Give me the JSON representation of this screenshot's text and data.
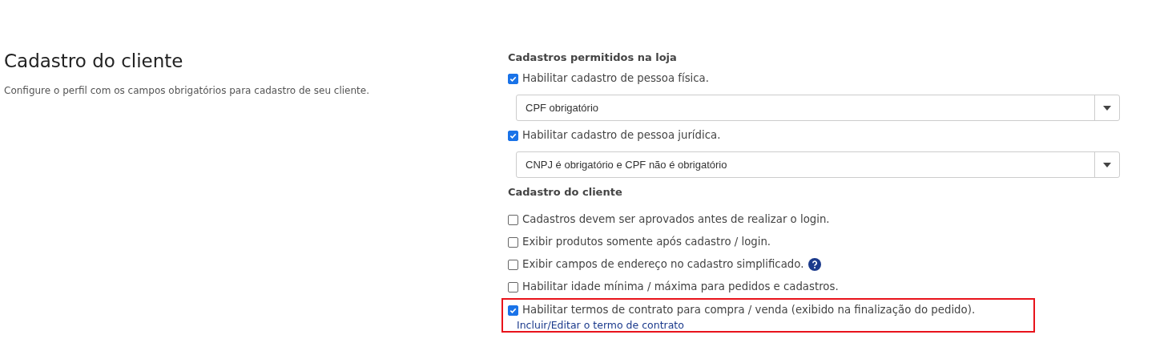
{
  "intro": {
    "title": "Cadastro do cliente",
    "description": "Configure o perfil com os campos obrigatórios para cadastro de seu cliente."
  },
  "sections": [
    {
      "heading": "Cadastros permitidos na loja",
      "items": [
        {
          "kind": "checkbox",
          "label": "Habilitar cadastro de pessoa física.",
          "checked": true
        },
        {
          "kind": "select",
          "value": "CPF obrigatório"
        },
        {
          "kind": "checkbox",
          "label": "Habilitar cadastro de pessoa jurídica.",
          "checked": true
        },
        {
          "kind": "select",
          "value": "CNPJ é obrigatório e CPF não é obrigatório"
        }
      ]
    },
    {
      "heading": "Cadastro do cliente",
      "items": [
        {
          "kind": "checkbox",
          "label": "Cadastros devem ser aprovados antes de realizar o login.",
          "checked": false
        },
        {
          "kind": "checkbox",
          "label": "Exibir produtos somente após cadastro / login.",
          "checked": false
        },
        {
          "kind": "checkbox",
          "label": "Exibir campos de endereço no cadastro simplificado.",
          "checked": false,
          "help": true
        },
        {
          "kind": "checkbox",
          "label": "Habilitar idade mínima / máxima para pedidos e cadastros.",
          "checked": false
        },
        {
          "kind": "checkbox",
          "label": "Habilitar termos de contrato para compra / venda (exibido na finalização do pedido).",
          "checked": true,
          "highlighted": true,
          "link": "Incluir/Editar o termo de contrato"
        }
      ]
    }
  ]
}
